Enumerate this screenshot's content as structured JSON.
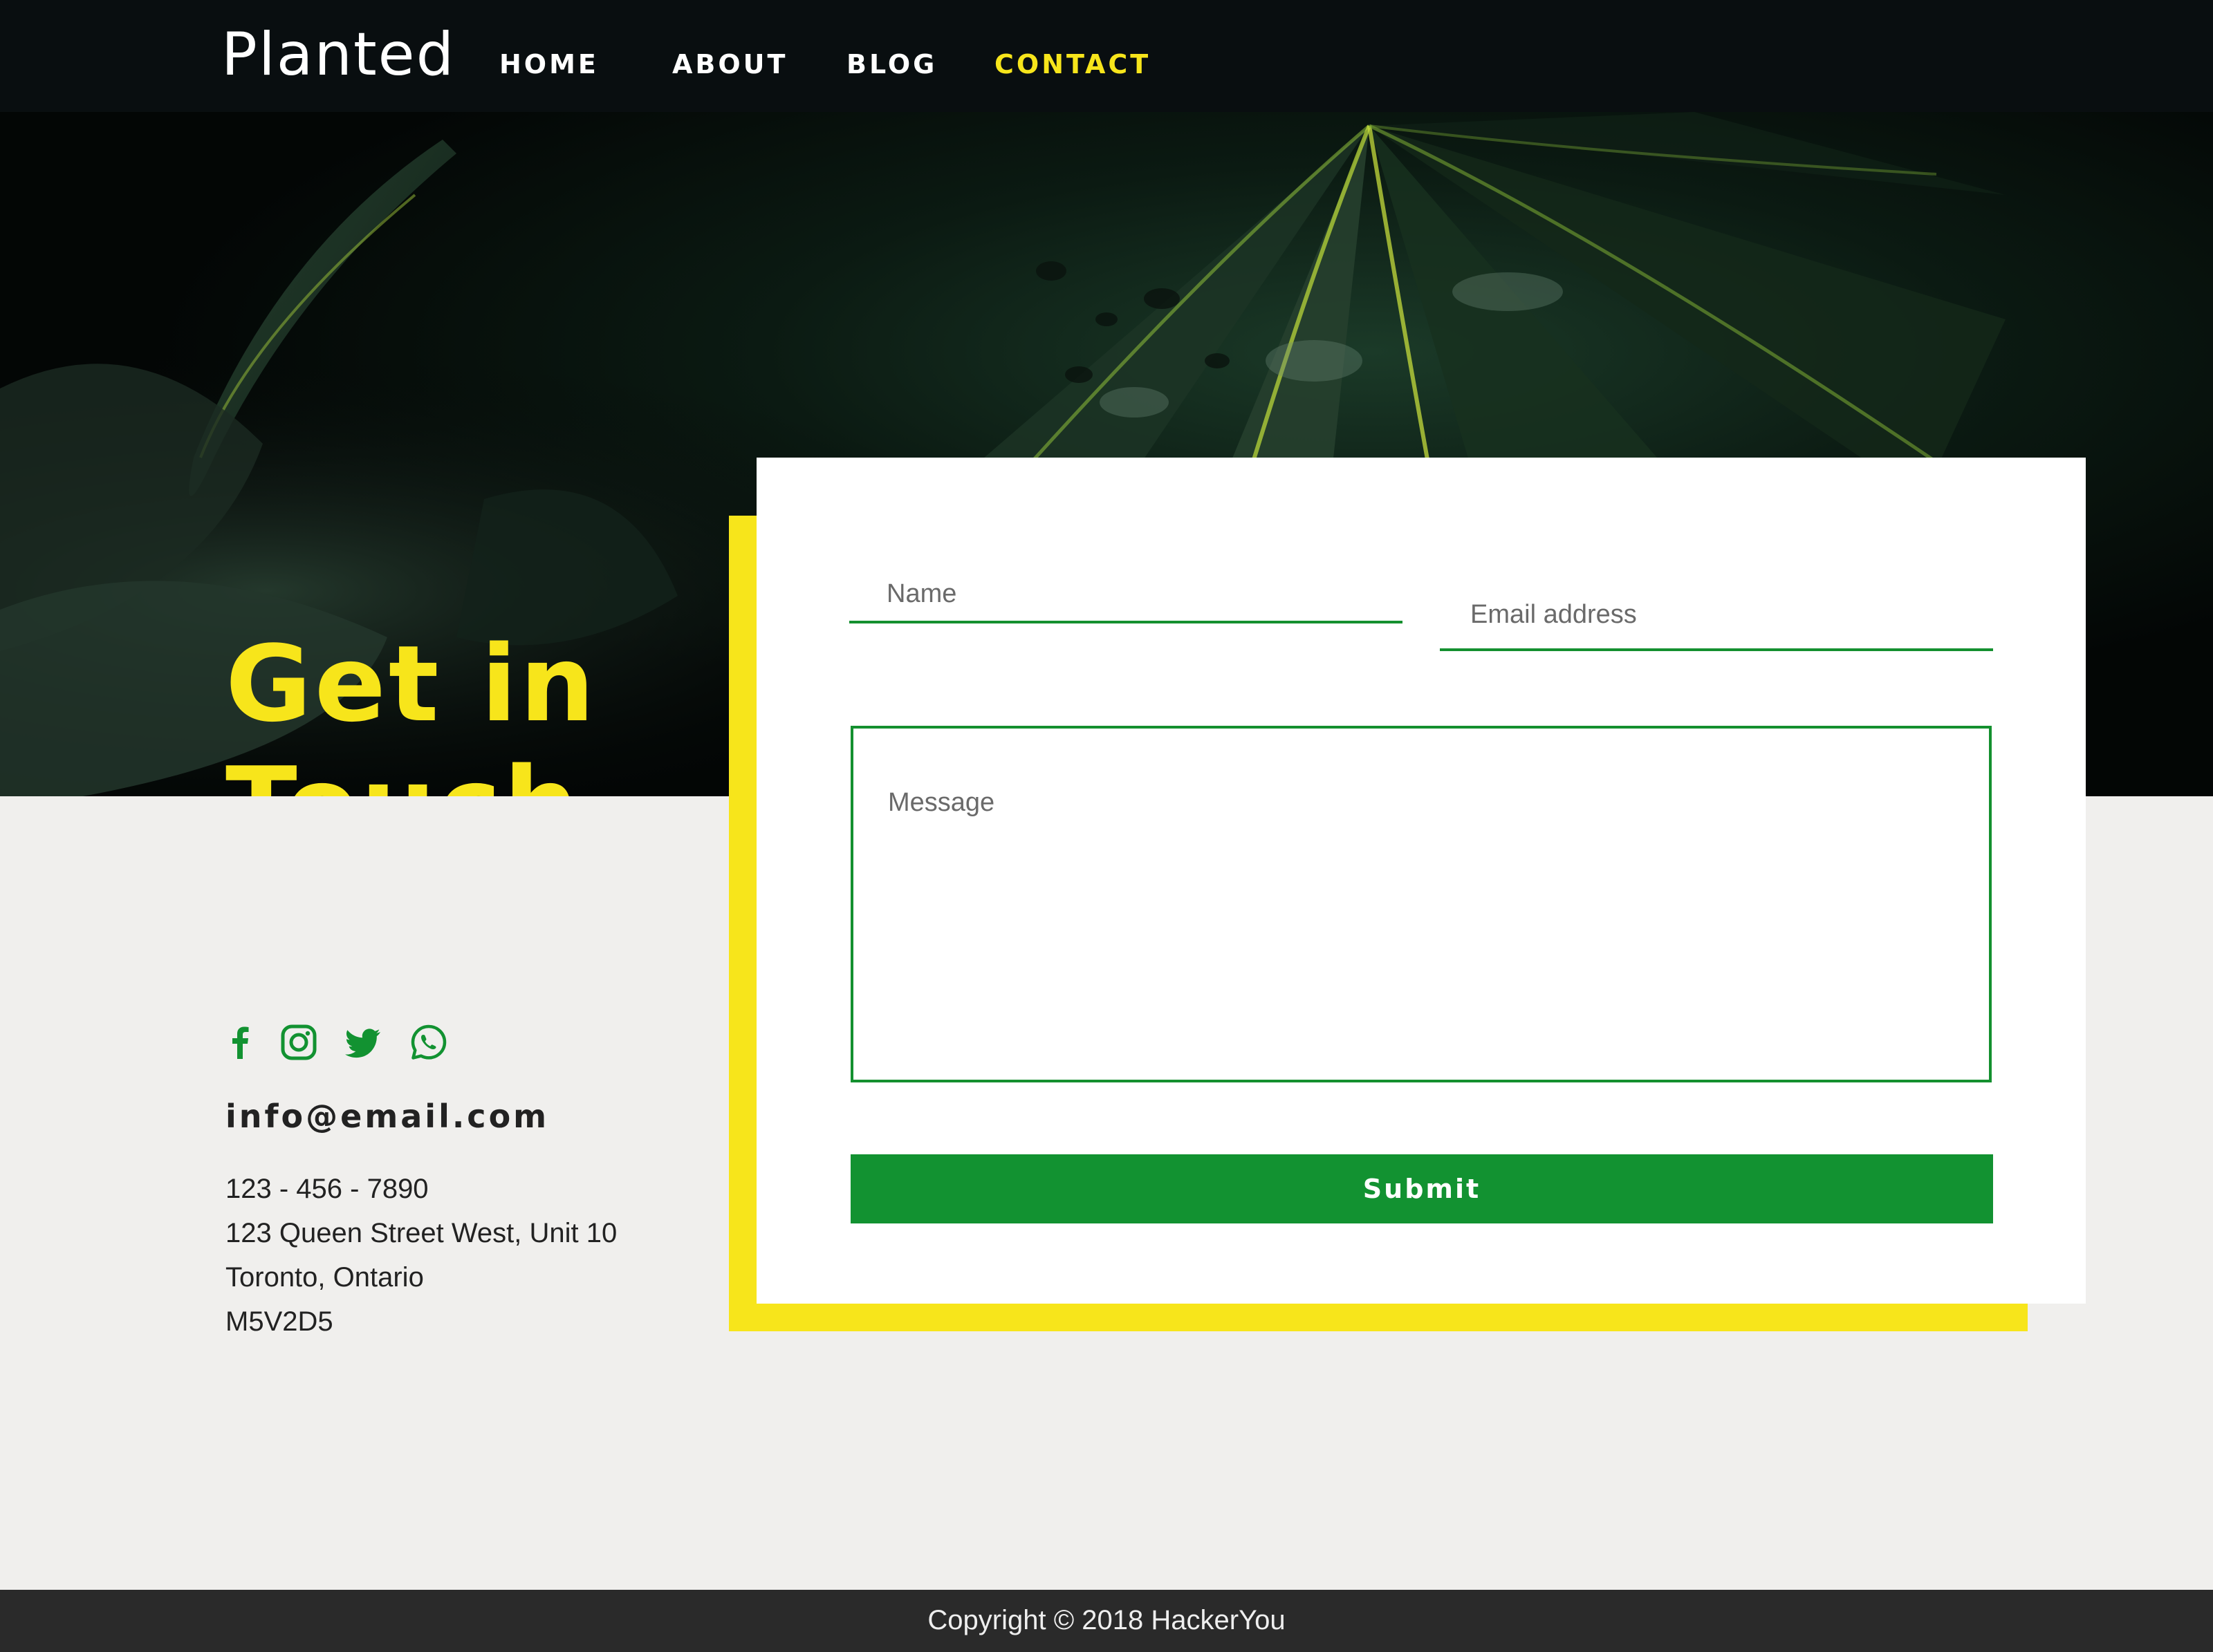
{
  "brand": {
    "logo": "Planted"
  },
  "nav": {
    "items": [
      {
        "label": "HOME"
      },
      {
        "label": "ABOUT"
      },
      {
        "label": "BLOG"
      },
      {
        "label": "CONTACT",
        "active": true
      }
    ]
  },
  "hero": {
    "title_line1": "Get in",
    "title_line2": "Touch"
  },
  "form": {
    "name_placeholder": "Name",
    "email_placeholder": "Email address",
    "message_placeholder": "Message",
    "submit_label": "Submit"
  },
  "contact": {
    "social": [
      "facebook-icon",
      "instagram-icon",
      "twitter-icon",
      "whatsapp-icon"
    ],
    "email": "info@email.com",
    "phone": "123 - 456 - 7890",
    "street": "123 Queen Street West, Unit 10",
    "city": "Toronto, Ontario",
    "postal": "M5V2D5"
  },
  "footer": {
    "copyright": "Copyright © 2018 HackerYou"
  },
  "colors": {
    "accent_yellow": "#f7e51b",
    "accent_green": "#129231",
    "nav_bg": "#090e10",
    "page_bg": "#f0efed",
    "footer_bg": "#2a2a2a"
  }
}
